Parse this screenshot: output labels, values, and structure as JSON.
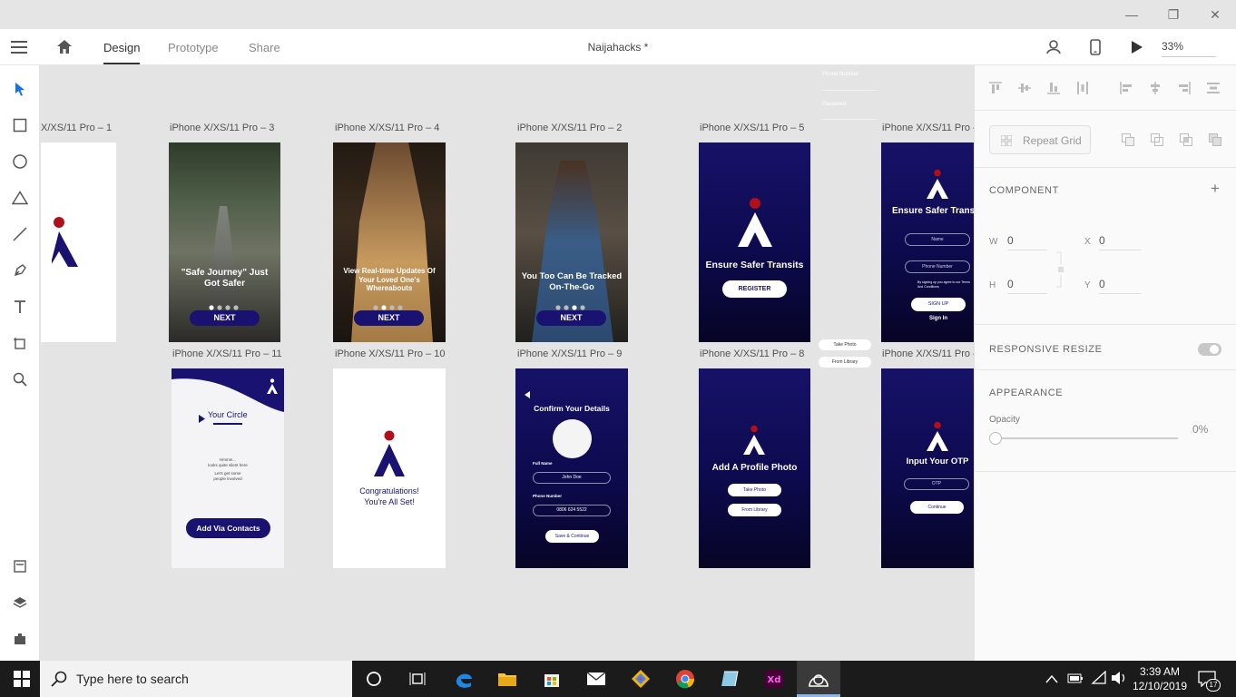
{
  "window": {
    "title": "Naijahacks *",
    "minimize": "—",
    "restore": "❐",
    "close": "✕"
  },
  "toolbar": {
    "tabs": [
      "Design",
      "Prototype",
      "Share"
    ],
    "active_tab": "Design",
    "zoom": "33%"
  },
  "left_tools": [
    "select-icon",
    "rectangle-icon",
    "ellipse-icon",
    "polygon-icon",
    "line-icon",
    "pen-icon",
    "text-icon",
    "artboard-icon",
    "zoom-icon",
    "assets-icon",
    "layers-icon",
    "plugins-icon"
  ],
  "artboards": {
    "row1": [
      {
        "label": "X/XS/11 Pro – 1"
      },
      {
        "label": "iPhone X/XS/11 Pro – 3",
        "caption": "\"Safe Journey\" Just Got Safer",
        "button": "NEXT"
      },
      {
        "label": "iPhone X/XS/11 Pro – 4",
        "caption": "View Real-time Updates Of Your Loved One's Whereabouts",
        "button": "NEXT"
      },
      {
        "label": "iPhone X/XS/11 Pro – 2",
        "caption": "You Too Can Be Tracked On-The-Go",
        "button": "NEXT"
      },
      {
        "label": "iPhone X/XS/11 Pro – 5",
        "caption": "Ensure Safer Transits",
        "button": "REGISTER"
      },
      {
        "label": "iPhone X/XS/11 Pro –",
        "caption": "Ensure Safer Trans",
        "fields": [
          "Name",
          "Phone Number"
        ],
        "terms": "By signing up you agree to our Terms And Conditions",
        "button": "SIGN UP",
        "link": "Sign In"
      }
    ],
    "row2": [
      {
        "label": "iPhone X/XS/11 Pro – 11",
        "heading": "Your Circle",
        "empty1": "Hmmm...",
        "empty2": "looks quite silent here",
        "empty3": "Let's get some",
        "empty4": "people involved",
        "button": "Add Via Contacts"
      },
      {
        "label": "iPhone X/XS/11 Pro – 10",
        "line1": "Congratulations!",
        "line2": "You're All Set!"
      },
      {
        "label": "iPhone X/XS/11 Pro – 9",
        "title": "Confirm Your Details",
        "name_label": "Full Name",
        "name_value": "John Doe",
        "phone_label": "Phone Number",
        "phone_value": "0806 624 5522",
        "button": "Save & Continue"
      },
      {
        "label": "iPhone X/XS/11 Pro – 8",
        "title": "Add A Profile Photo",
        "btn1": "Take Photo",
        "btn2": "From Library"
      },
      {
        "label": "iPhone X/XS/11 Pro –",
        "title": "Input Your OTP",
        "field": "OTP",
        "button": "Continue"
      }
    ],
    "floating": {
      "phone": "Phone Number",
      "password": "Password",
      "take": "Take Photo",
      "library": "From Library"
    }
  },
  "right_panel": {
    "repeat_grid": "Repeat Grid",
    "component": "COMPONENT",
    "w_label": "W",
    "w_value": "0",
    "h_label": "H",
    "h_value": "0",
    "x_label": "X",
    "x_value": "0",
    "y_label": "Y",
    "y_value": "0",
    "responsive_resize": "RESPONSIVE RESIZE",
    "appearance": "APPEARANCE",
    "opacity_label": "Opacity",
    "opacity_value": "0%"
  },
  "taskbar": {
    "search_placeholder": "Type here to search",
    "time": "3:39 AM",
    "date": "12/10/2019",
    "notifications": "17"
  },
  "colors": {
    "brand_navy": "#1a1270",
    "brand_red": "#b0101a",
    "accent_blue": "#1473e6"
  }
}
